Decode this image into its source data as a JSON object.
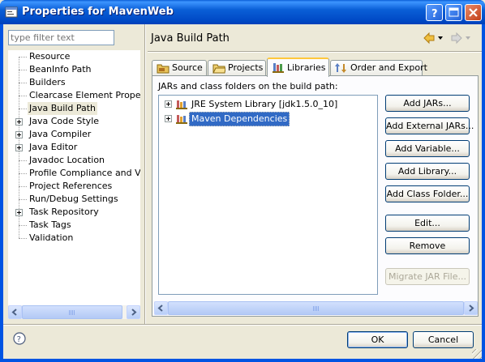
{
  "window": {
    "title": "Properties for MavenWeb"
  },
  "left": {
    "filter_placeholder": "type filter text",
    "tree_items": [
      {
        "label": "Resource",
        "expandable": false
      },
      {
        "label": "BeanInfo Path",
        "expandable": false
      },
      {
        "label": "Builders",
        "expandable": false
      },
      {
        "label": "Clearcase Element Properties",
        "expandable": false
      },
      {
        "label": "Java Build Path",
        "expandable": false,
        "selected": true
      },
      {
        "label": "Java Code Style",
        "expandable": true
      },
      {
        "label": "Java Compiler",
        "expandable": true
      },
      {
        "label": "Java Editor",
        "expandable": true
      },
      {
        "label": "Javadoc Location",
        "expandable": false
      },
      {
        "label": "Profile Compliance and Validation",
        "expandable": false
      },
      {
        "label": "Project References",
        "expandable": false
      },
      {
        "label": "Run/Debug Settings",
        "expandable": false
      },
      {
        "label": "Task Repository",
        "expandable": true
      },
      {
        "label": "Task Tags",
        "expandable": false
      },
      {
        "label": "Validation",
        "expandable": false
      }
    ]
  },
  "page": {
    "title": "Java Build Path",
    "tabs": [
      {
        "label": "Source",
        "icon": "source-folder-icon"
      },
      {
        "label": "Projects",
        "icon": "projects-folder-icon"
      },
      {
        "label": "Libraries",
        "icon": "libraries-icon",
        "active": true
      },
      {
        "label": "Order and Export",
        "icon": "order-export-icon"
      }
    ],
    "libraries_label": "JARs and class folders on the build path:",
    "libraries": [
      {
        "label": "JRE System Library [jdk1.5.0_10]",
        "selected": false
      },
      {
        "label": "Maven Dependencies",
        "selected": true
      }
    ],
    "buttons": {
      "add_jars": "Add JARs...",
      "add_external_jars": "Add External JARs...",
      "add_variable": "Add Variable...",
      "add_library": "Add Library...",
      "add_class_folder": "Add Class Folder...",
      "edit": "Edit...",
      "remove": "Remove",
      "migrate_jar": "Migrate JAR File..."
    }
  },
  "footer": {
    "ok": "OK",
    "cancel": "Cancel"
  },
  "colors": {
    "titlebar": "#0054e3",
    "selection": "#316ac5",
    "active_tab_accent": "#ffc83c"
  }
}
